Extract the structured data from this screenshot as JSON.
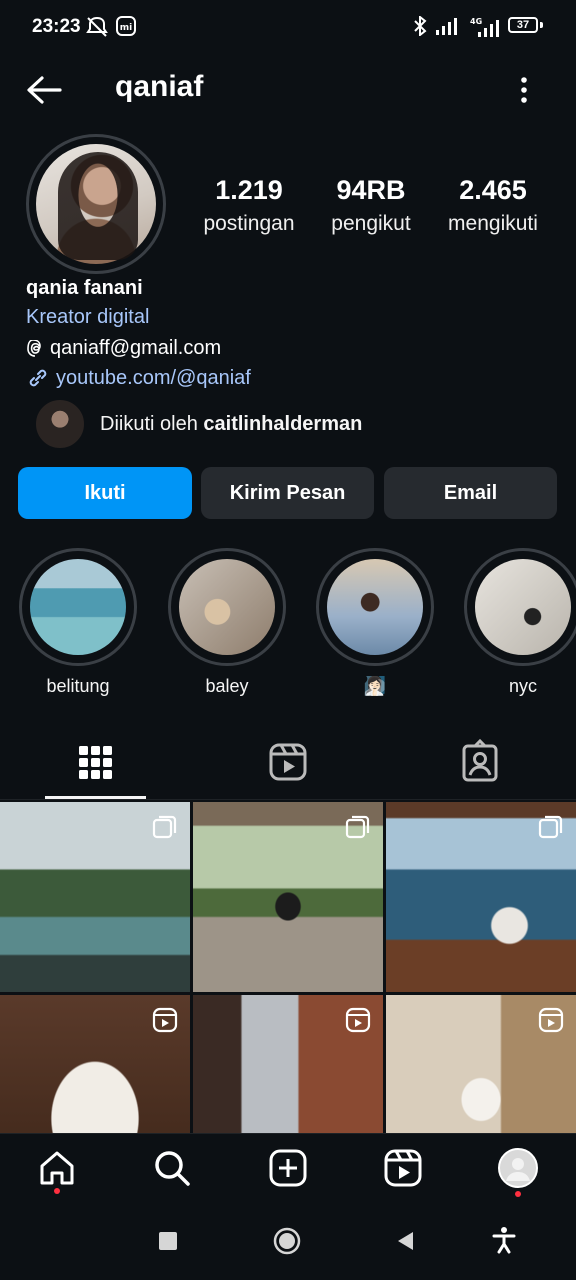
{
  "status_bar": {
    "time": "23:23",
    "battery": "37"
  },
  "header": {
    "username": "qaniaf"
  },
  "stats": [
    {
      "value": "1.219",
      "label": "postingan"
    },
    {
      "value": "94RB",
      "label": "pengikut"
    },
    {
      "value": "2.465",
      "label": "mengikuti"
    }
  ],
  "bio": {
    "name": "qania fanani",
    "category": "Kreator digital",
    "threads_handle": "qaniaff@gmail.com",
    "link": "youtube.com/@qaniaf"
  },
  "followed_by": {
    "prefix": "Diikuti oleh ",
    "user": "caitlinhalderman"
  },
  "buttons": {
    "follow": "Ikuti",
    "message": "Kirim Pesan",
    "email": "Email"
  },
  "highlights": [
    {
      "label": "belitung"
    },
    {
      "label": "baley"
    },
    {
      "label": "🧖🏻‍♀️"
    },
    {
      "label": "nyc"
    }
  ],
  "tabs": [
    "grid",
    "reels",
    "tagged"
  ],
  "colors": {
    "accent": "#0095f6",
    "background": "#0c1014",
    "link": "#a8c7fa",
    "secondary_button": "#262a2f",
    "notification_dot": "#ff3040"
  }
}
